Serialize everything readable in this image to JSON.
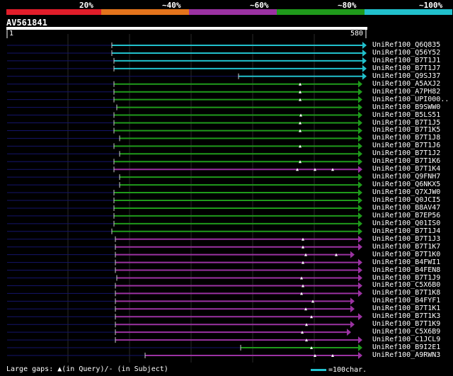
{
  "legend": {
    "colors": [
      "#e11d2a",
      "#e4741c",
      "#9b32a2",
      "#1f9a1b",
      "#21c0cc"
    ],
    "labels": [
      "20%",
      "~40%",
      "~60%",
      "~80%",
      "~100%"
    ]
  },
  "query": {
    "title": "AV561841",
    "start": "1",
    "end": "580"
  },
  "hits": [
    {
      "label": "UniRef100_Q6Q835",
      "color": "#21c0cc",
      "start": 158,
      "end": 517,
      "marks": []
    },
    {
      "label": "UniRef100_Q56Y52",
      "color": "#21c0cc",
      "start": 158,
      "end": 517,
      "marks": []
    },
    {
      "label": "UniRef100_B7T1J1",
      "color": "#21c0cc",
      "start": 161,
      "end": 517,
      "marks": []
    },
    {
      "label": "UniRef100_B7T1J7",
      "color": "#21c0cc",
      "start": 161,
      "end": 517,
      "marks": []
    },
    {
      "label": "UniRef100_Q9SJ37",
      "color": "#21c0cc",
      "start": 337,
      "end": 517,
      "marks": []
    },
    {
      "label": "UniRef100_A5AXJ2",
      "color": "#1f9a1b",
      "start": 161,
      "end": 511,
      "marks": [
        424
      ]
    },
    {
      "label": "UniRef100_A7PH82",
      "color": "#1f9a1b",
      "start": 161,
      "end": 511,
      "marks": [
        424
      ]
    },
    {
      "label": "UniRef100_UPI000..",
      "color": "#1f9a1b",
      "start": 161,
      "end": 511,
      "marks": [
        424
      ]
    },
    {
      "label": "UniRef100_B9SWW0",
      "color": "#1f9a1b",
      "start": 165,
      "end": 511,
      "marks": []
    },
    {
      "label": "UniRef100_B5LS51",
      "color": "#1f9a1b",
      "start": 161,
      "end": 511,
      "marks": [
        425
      ]
    },
    {
      "label": "UniRef100_B7T1J5",
      "color": "#1f9a1b",
      "start": 161,
      "end": 511,
      "marks": [
        424
      ]
    },
    {
      "label": "UniRef100_B7T1K5",
      "color": "#1f9a1b",
      "start": 161,
      "end": 511,
      "marks": [
        424
      ]
    },
    {
      "label": "UniRef100_B7T1J8",
      "color": "#1f9a1b",
      "start": 169,
      "end": 511,
      "marks": []
    },
    {
      "label": "UniRef100_B7T1J6",
      "color": "#1f9a1b",
      "start": 161,
      "end": 511,
      "marks": [
        424
      ]
    },
    {
      "label": "UniRef100_B7T1J2",
      "color": "#1f9a1b",
      "start": 169,
      "end": 511,
      "marks": []
    },
    {
      "label": "UniRef100_B7T1K6",
      "color": "#1f9a1b",
      "start": 161,
      "end": 511,
      "marks": [
        424
      ]
    },
    {
      "label": "UniRef100_B7T1K4",
      "color": "#9b32a2",
      "start": 161,
      "end": 511,
      "marks": [
        420,
        445,
        470
      ]
    },
    {
      "label": "UniRef100_Q9FNH7",
      "color": "#1f9a1b",
      "start": 169,
      "end": 511,
      "marks": []
    },
    {
      "label": "UniRef100_Q6NKX5",
      "color": "#1f9a1b",
      "start": 169,
      "end": 511,
      "marks": []
    },
    {
      "label": "UniRef100_Q7XJW0",
      "color": "#1f9a1b",
      "start": 161,
      "end": 511,
      "marks": []
    },
    {
      "label": "UniRef100_Q0JCI5",
      "color": "#1f9a1b",
      "start": 161,
      "end": 511,
      "marks": []
    },
    {
      "label": "UniRef100_B8AV47",
      "color": "#1f9a1b",
      "start": 161,
      "end": 511,
      "marks": []
    },
    {
      "label": "UniRef100_B7EP56",
      "color": "#1f9a1b",
      "start": 161,
      "end": 511,
      "marks": []
    },
    {
      "label": "UniRef100_Q01IS0",
      "color": "#1f9a1b",
      "start": 161,
      "end": 511,
      "marks": []
    },
    {
      "label": "UniRef100_B7T1J4",
      "color": "#1f9a1b",
      "start": 158,
      "end": 511,
      "marks": []
    },
    {
      "label": "UniRef100_B7T1J3",
      "color": "#9b32a2",
      "start": 163,
      "end": 511,
      "marks": [
        428
      ]
    },
    {
      "label": "UniRef100_B7T1K7",
      "color": "#9b32a2",
      "start": 163,
      "end": 511,
      "marks": [
        428
      ]
    },
    {
      "label": "UniRef100_B7T1K0",
      "color": "#9b32a2",
      "start": 163,
      "end": 500,
      "marks": [
        432,
        475
      ]
    },
    {
      "label": "UniRef100_B4FWI1",
      "color": "#9b32a2",
      "start": 163,
      "end": 511,
      "marks": [
        428
      ]
    },
    {
      "label": "UniRef100_B4FEN8",
      "color": "#9b32a2",
      "start": 163,
      "end": 511,
      "marks": []
    },
    {
      "label": "UniRef100_B7T1J9",
      "color": "#9b32a2",
      "start": 165,
      "end": 511,
      "marks": [
        426
      ]
    },
    {
      "label": "UniRef100_C5X6B0",
      "color": "#9b32a2",
      "start": 163,
      "end": 511,
      "marks": [
        428
      ]
    },
    {
      "label": "UniRef100_B7T1K8",
      "color": "#9b32a2",
      "start": 163,
      "end": 511,
      "marks": [
        426
      ]
    },
    {
      "label": "UniRef100_B4FYF1",
      "color": "#9b32a2",
      "start": 163,
      "end": 500,
      "marks": [
        442
      ]
    },
    {
      "label": "UniRef100_B7T1K1",
      "color": "#9b32a2",
      "start": 163,
      "end": 500,
      "marks": [
        432
      ]
    },
    {
      "label": "UniRef100_B7T1K3",
      "color": "#9b32a2",
      "start": 163,
      "end": 511,
      "marks": [
        440
      ]
    },
    {
      "label": "UniRef100_B7T1K9",
      "color": "#9b32a2",
      "start": 163,
      "end": 500,
      "marks": [
        433
      ]
    },
    {
      "label": "UniRef100_C5X6B9",
      "color": "#9b32a2",
      "start": 163,
      "end": 495,
      "marks": [
        427
      ]
    },
    {
      "label": "UniRef100_C1JCL9",
      "color": "#9b32a2",
      "start": 163,
      "end": 511,
      "marks": [
        433
      ]
    },
    {
      "label": "UniRef100_B9I2E1",
      "color": "#1f9a1b",
      "start": 340,
      "end": 511,
      "marks": [
        440
      ]
    },
    {
      "label": "UniRef100_A9RWN3",
      "color": "#9b32a2",
      "start": 205,
      "end": 511,
      "marks": [
        445,
        470
      ]
    }
  ],
  "footer": {
    "left": "Large gaps: ▲(in Query)/- (in Subject)",
    "right": "=100char."
  }
}
